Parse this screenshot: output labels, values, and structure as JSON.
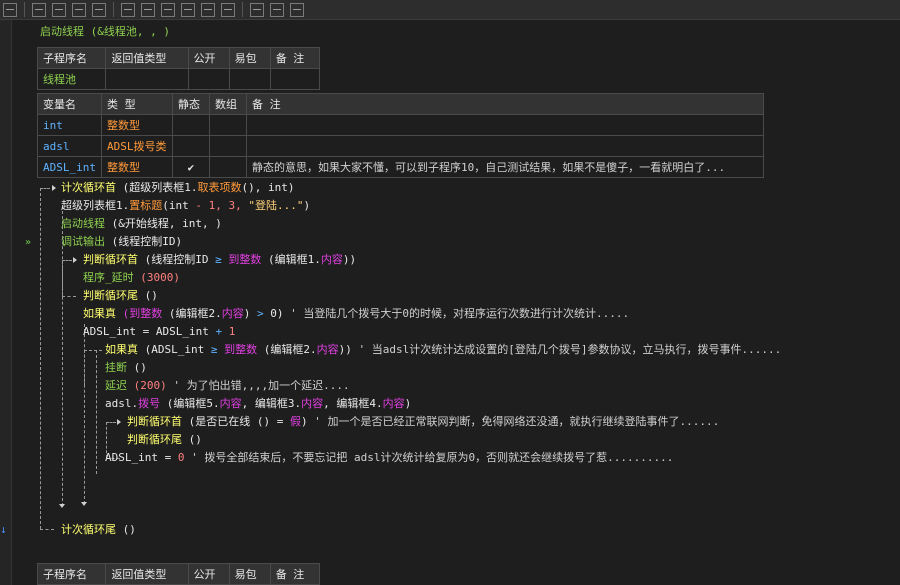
{
  "toolbar": {
    "icons": [
      "table-icon",
      "align-left-icon",
      "align-right-icon",
      "align-top-icon",
      "align-bottom-icon",
      "same-width-icon",
      "same-height-icon",
      "center-h-icon",
      "center-v-icon",
      "spread-h-icon",
      "spread-v-icon",
      "grid-h-icon",
      "grid-v-icon",
      "lock-icon"
    ]
  },
  "line1": {
    "kw": "启动线程",
    "args": "(&线程池, , )"
  },
  "sub_table": {
    "headers": [
      "子程序名",
      "返回值类型",
      "公开",
      "易包",
      "备 注"
    ],
    "row": [
      "线程池",
      "",
      "",
      "",
      ""
    ]
  },
  "var_table": {
    "headers": [
      "变量名",
      "类 型",
      "静态",
      "数组",
      "备 注"
    ],
    "rows": [
      {
        "name": "int",
        "type": "整数型",
        "static": "",
        "array": "",
        "note": ""
      },
      {
        "name": "adsl",
        "type": "ADSL拨号类",
        "static": "",
        "array": "",
        "note": ""
      },
      {
        "name": "ADSL_int",
        "type": "整数型",
        "static": "✔",
        "array": "",
        "note": "静态的意思，如果大家不懂，可以到子程序10，自己测试结果，如果不是傻子，一看就明白了..."
      }
    ]
  },
  "code": {
    "l1_kw": "计次循环首",
    "l1_a": "(超级列表框1.",
    "l1_m": "取表项数",
    "l1_b": "(), int)",
    "l2_a": "超级列表框1.",
    "l2_m": "置标题",
    "l2_b": "(int",
    "l2_op": " - 1,",
    "l2_n": " 3,",
    "l2_s": " \"登陆...\"",
    "l2_c": ")",
    "l3_kw": "启动线程",
    "l3_a": "(&开始线程, int, )",
    "l4_kw": "调试输出",
    "l4_a": "(线程控制ID)",
    "l5_kw": "判断循环首",
    "l5_a": "(线程控制ID",
    "l5_op": " ≥ ",
    "l5_f": "到整数",
    "l5_b": " (编辑框1.",
    "l5_m": "内容",
    "l5_c": "))",
    "l6_kw": "程序_延时",
    "l6_n": "(3000)",
    "l7_kw": "判断循环尾",
    "l7_a": "()",
    "l8_kw": "如果真",
    "l8_f": "(到整数",
    "l8_b": " (编辑框2.",
    "l8_m": "内容",
    "l8_c": ")",
    "l8_op": " > ",
    "l8_n": "0)",
    "l8_cm": " ' 当登陆几个拨号大于0的时候，对程序运行次数进行计次统计.....",
    "l9_a": "ADSL_int = ADSL_int",
    "l9_op": " + ",
    "l9_n": "1",
    "l10_kw": "如果真",
    "l10_a": "(ADSL_int",
    "l10_op": " ≥ ",
    "l10_f": "到整数",
    "l10_b": " (编辑框2.",
    "l10_m": "内容",
    "l10_c": "))",
    "l10_cm": " ' 当adsl计次统计达成设置的[登陆几个拨号]参数协议，立马执行，拨号事件......",
    "l11_kw": "挂断",
    "l11_a": "()",
    "l12_kw": "延迟",
    "l12_n": "(200)",
    "l12_cm": " ' 为了怕出错,,,,加一个延迟....",
    "l13_a": "adsl.",
    "l13_m1": "拨号",
    "l13_b": " (编辑框5.",
    "l13_m2": "内容",
    "l13_c": ", 编辑框3.",
    "l13_m3": "内容",
    "l13_d": ", 编辑框4.",
    "l13_m4": "内容",
    "l13_e": ")",
    "l14_kw": "判断循环首",
    "l14_a": "(是否已在线 () =",
    "l14_v": " 假",
    "l14_b": ")",
    "l14_cm": " ' 加一个是否已经正常联网判断，免得网络还没通，就执行继续登陆事件了......",
    "l15_kw": "判断循环尾",
    "l15_a": "()",
    "l16_a": "ADSL_int = ",
    "l16_n": "0",
    "l16_cm": " ' 拨号全部结束后，不要忘记把 adsl计次统计给复原为0，否则就还会继续拨号了惹..........",
    "l17_kw": "计次循环尾",
    "l17_a": "()"
  },
  "sub_table2": {
    "headers": [
      "子程序名",
      "返回值类型",
      "公开",
      "易包",
      "备 注"
    ]
  }
}
